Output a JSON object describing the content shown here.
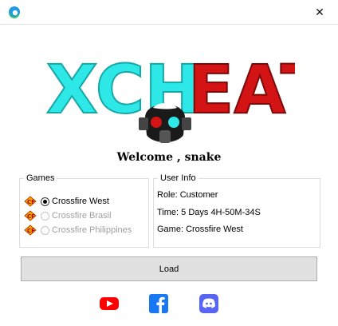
{
  "window": {
    "close_glyph": "✕"
  },
  "logo": {
    "text_left": "XCH",
    "text_right": "EAT"
  },
  "welcome": "Welcome , snake",
  "games": {
    "title": "Games",
    "items": [
      {
        "label": "Crossfire West",
        "checked": true,
        "enabled": true
      },
      {
        "label": "Crossfire Brasil",
        "checked": false,
        "enabled": false
      },
      {
        "label": "Crossfire Philippines",
        "checked": false,
        "enabled": false
      }
    ]
  },
  "user_info": {
    "title": "User Info",
    "role": "Role: Customer",
    "time": "Time: 5 Days 4H-50M-34S",
    "game": "Game: Crossfire West"
  },
  "load_label": "Load",
  "colors": {
    "cyan": "#2ee8e8",
    "red": "#d41414",
    "youtube": "#ff0000",
    "facebook": "#1877f2",
    "discord": "#5865f2"
  },
  "icons": [
    "edge-icon",
    "close-icon",
    "gas-mask-icon",
    "crossfire-icon",
    "youtube-icon",
    "facebook-icon",
    "discord-icon"
  ]
}
